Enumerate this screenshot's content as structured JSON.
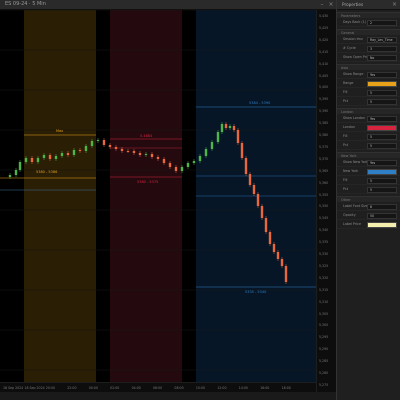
{
  "window": {
    "title": "ES 09-24 · 5 Min",
    "minimize": "–",
    "close": "×"
  },
  "panel": {
    "title": "Properties",
    "close": "×",
    "sections": [
      {
        "name": "Parameters",
        "rows": [
          {
            "label": "Days Back (1)",
            "value": "2"
          }
        ]
      },
      {
        "name": "General",
        "rows": [
          {
            "label": "Session tmz",
            "value": "Ray_Lev_Time"
          },
          {
            "label": "# Cycle",
            "value": "3"
          },
          {
            "label": "Show Open Price",
            "value": "No"
          }
        ]
      },
      {
        "name": "Asia",
        "rows": [
          {
            "label": "Show Range",
            "value": "Yes"
          },
          {
            "label": "Range",
            "color": "#e8a21a"
          },
          {
            "label": "Fill",
            "value": "5"
          },
          {
            "label": "Pct",
            "value": "5"
          }
        ]
      },
      {
        "name": "London",
        "rows": [
          {
            "label": "Show London",
            "value": "Yes"
          },
          {
            "label": "London",
            "color": "#d6243f"
          },
          {
            "label": "Fill",
            "value": "5"
          },
          {
            "label": "Pct",
            "value": "5"
          }
        ]
      },
      {
        "name": "New York",
        "rows": [
          {
            "label": "Show New York",
            "value": "Yes"
          },
          {
            "label": "New York",
            "color": "#2e7fc6"
          },
          {
            "label": "Fill",
            "value": "5"
          },
          {
            "label": "Pct",
            "value": "5"
          }
        ]
      },
      {
        "name": "Other",
        "rows": [
          {
            "label": "Label Font Size",
            "value": "6"
          },
          {
            "label": "Opacity",
            "value": "50"
          },
          {
            "label": "Label Price",
            "color": "#f5efae"
          }
        ]
      }
    ]
  },
  "chart_labels": {
    "asia_high": "Max",
    "asia_low": "5380 - 5386",
    "london_high": "5.4884",
    "london_low": "5380 - 5375",
    "ny_high": "5384 - 5390",
    "ny_low": "5335 - 5340"
  },
  "colors": {
    "asia": "#e8a21a",
    "london": "#d6243f",
    "ny": "#2e7fc6",
    "up": "#4fb54a",
    "down": "#e8673c"
  },
  "yaxis_ticks": [
    "5,430",
    "5,425",
    "5,420",
    "5,415",
    "5,410",
    "5,405",
    "5,400",
    "5,395",
    "5,390",
    "5,385",
    "5,380",
    "5,375",
    "5,370",
    "5,365",
    "5,360",
    "5,355",
    "5,350",
    "5,345",
    "5,340",
    "5,335",
    "5,330",
    "5,325",
    "5,320",
    "5,315",
    "5,310",
    "5,305",
    "5,300",
    "5,295",
    "5,290",
    "5,285",
    "5,280",
    "5,275"
  ],
  "xaxis_ticks": [
    "18 Sep 2024",
    "18 Sep 2024",
    "20:00",
    "22:00",
    "00:00",
    "02:00",
    "04:00",
    "06:00",
    "08:00",
    "10:00",
    "12:00",
    "14:00",
    "16:00",
    "18:00"
  ],
  "price_marker": "5,341"
}
